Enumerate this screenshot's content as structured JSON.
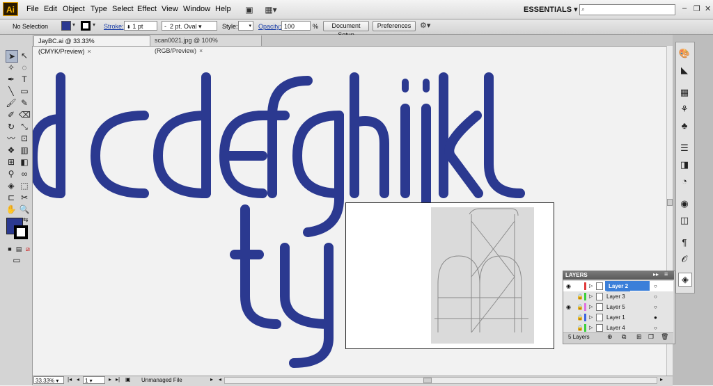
{
  "app": {
    "logo": "Ai",
    "brand_color": "#f7b500"
  },
  "menu": [
    "File",
    "Edit",
    "Object",
    "Type",
    "Select",
    "Effect",
    "View",
    "Window",
    "Help"
  ],
  "workspace": {
    "label": "ESSENTIALS",
    "search_placeholder": ""
  },
  "control": {
    "selection": "No Selection",
    "fill_color": "#2b3990",
    "stroke_color": "#000000",
    "stroke_label": "Stroke:",
    "stroke_weight": "1 pt",
    "brush": "2 pt. Oval",
    "brush_prefix": "-",
    "style_label": "Style:",
    "opacity_label": "Opacity:",
    "opacity_value": "100",
    "opacity_unit": "%",
    "document_setup": "Document Setup",
    "preferences": "Preferences"
  },
  "tabs": [
    {
      "label": "JayBC.ai @ 33.33% (CMYK/Preview)",
      "close": "×"
    },
    {
      "label": "scan0021.jpg @ 100% (RGB/Preview)",
      "close": "×"
    }
  ],
  "artwork": {
    "glyph_color": "#2b3990",
    "letters_row1": "bcdefghijkl",
    "letters_row2": "ty"
  },
  "layers": {
    "title": "LAYERS",
    "items": [
      {
        "name": "Layer 2",
        "color": "#e03a3a",
        "selected": true
      },
      {
        "name": "Layer 3",
        "color": "#3ad03a",
        "selected": false
      },
      {
        "name": "Layer 5",
        "color": "#e06fe0",
        "selected": false
      },
      {
        "name": "Layer 1",
        "color": "#3a64e0",
        "selected": false
      },
      {
        "name": "Layer 4",
        "color": "#3ad03a",
        "selected": false
      }
    ],
    "count": "5 Layers"
  },
  "status": {
    "zoom": "33.33%",
    "artboard": "1",
    "info": "Unmanaged File"
  }
}
